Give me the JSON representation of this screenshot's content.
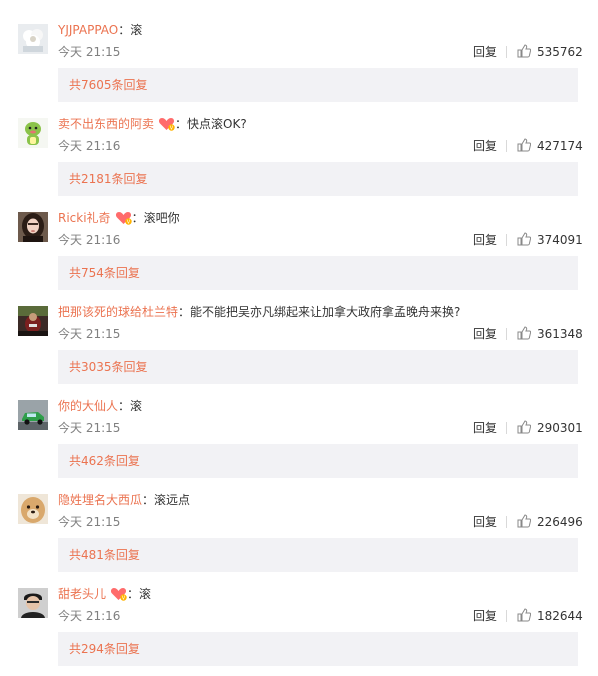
{
  "comments": [
    {
      "user": "YJJPAPPAO",
      "badge": false,
      "colon": "：",
      "text": "滚",
      "time": "今天 21:15",
      "reply": "回复",
      "likes": "535762",
      "replies_link": "共7605条回复",
      "avatar": "avatar-white-flowers"
    },
    {
      "user": "卖不出东西的阿卖",
      "badge": true,
      "colon": "：",
      "text": "快点滚OK?",
      "time": "今天 21:16",
      "reply": "回复",
      "likes": "427174",
      "replies_link": "共2181条回复",
      "avatar": "avatar-green-dinosaur"
    },
    {
      "user": "Ricki礼奇",
      "badge": true,
      "colon": "：",
      "text": "滚吧你",
      "time": "今天 21:16",
      "reply": "回复",
      "likes": "374091",
      "replies_link": "共754条回复",
      "avatar": "avatar-dark-hair-portrait"
    },
    {
      "user": "把那该死的球给杜兰特",
      "badge": false,
      "colon": "：",
      "text": "能不能把吴亦凡绑起来让加拿大政府拿孟晚舟来换?",
      "time": "今天 21:15",
      "reply": "回复",
      "likes": "361348",
      "replies_link": "共3035条回复",
      "avatar": "avatar-dark-red-photo"
    },
    {
      "user": "你的大仙人",
      "badge": false,
      "colon": "：",
      "text": "滚",
      "time": "今天 21:15",
      "reply": "回复",
      "likes": "290301",
      "replies_link": "共462条回复",
      "avatar": "avatar-green-car"
    },
    {
      "user": "隐姓埋名大西瓜",
      "badge": false,
      "colon": "：",
      "text": "滚远点",
      "time": "今天 21:15",
      "reply": "回复",
      "likes": "226496",
      "replies_link": "共481条回复",
      "avatar": "avatar-dog-face"
    },
    {
      "user": "甜老头儿",
      "badge": true,
      "colon": "：",
      "text": "滚",
      "time": "今天 21:16",
      "reply": "回复",
      "likes": "182644",
      "replies_link": "共294条回复",
      "avatar": "avatar-person-dark-cap"
    }
  ],
  "colors": {
    "username": "#eb7350",
    "replies_bg": "#f2f2f5",
    "meta": "#808080"
  }
}
